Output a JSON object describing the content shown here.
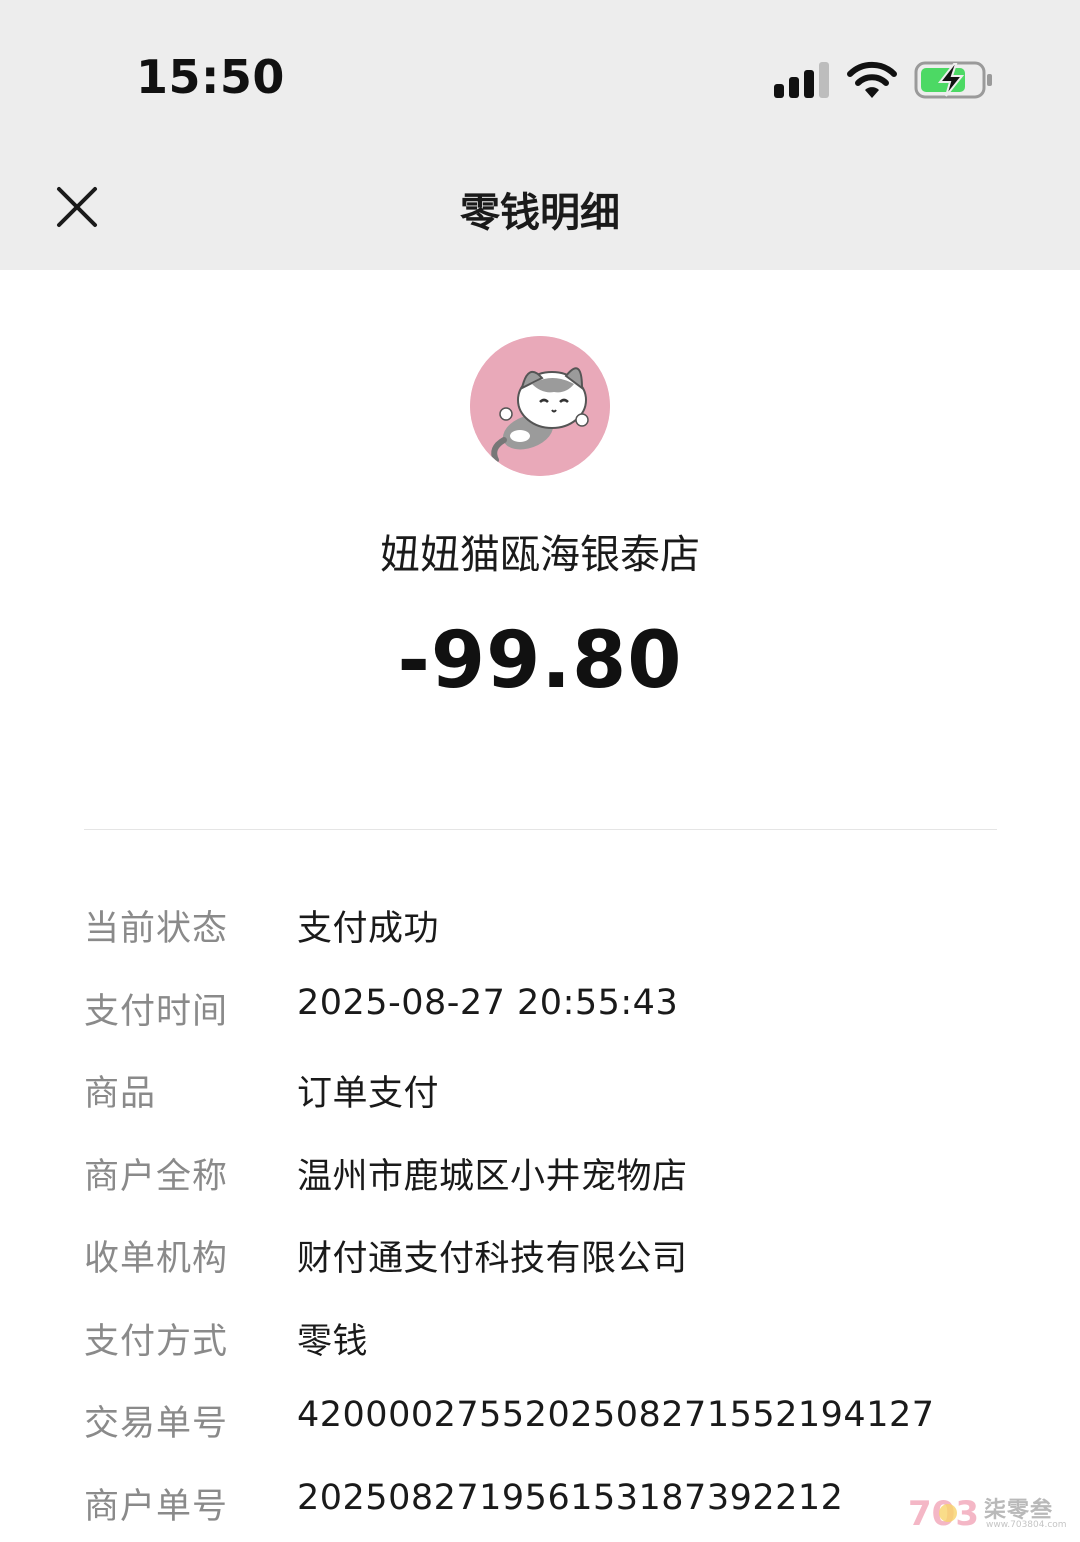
{
  "status_bar": {
    "time": "15:50",
    "icons": [
      "signal-icon",
      "wifi-icon",
      "battery-charging-icon"
    ]
  },
  "nav": {
    "title": "零钱明细",
    "close_icon": "close-icon"
  },
  "transaction": {
    "merchant_display_name": "妞妞猫瓯海银泰店",
    "amount": "-99.80",
    "avatar_icon": "cat-avatar-icon"
  },
  "details": [
    {
      "label": "当前状态",
      "value": "支付成功"
    },
    {
      "label": "支付时间",
      "value": "2025-08-27 20:55:43"
    },
    {
      "label": "商品",
      "value": "订单支付"
    },
    {
      "label": "商户全称",
      "value": "温州市鹿城区小井宠物店"
    },
    {
      "label": "收单机构",
      "value": "财付通支付科技有限公司"
    },
    {
      "label": "支付方式",
      "value": "零钱"
    },
    {
      "label": "交易单号",
      "value": "4200002755202508271552194127"
    },
    {
      "label": "商户单号",
      "value": "20250827195615318739​2212"
    }
  ],
  "watermark": {
    "logo_text": "703",
    "name": "柒零叁",
    "url": "www.703804.com"
  },
  "colors": {
    "header_bg": "#ededed",
    "label_gray": "#8a8a8a",
    "avatar_bg": "#e9a9b9",
    "battery_green": "#4cd964"
  }
}
